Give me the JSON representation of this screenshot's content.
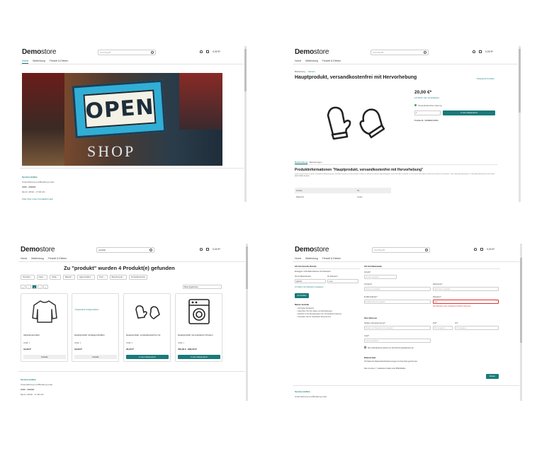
{
  "header": {
    "logo_bold": "Demo",
    "logo_light": "store",
    "search_placeholder": "Suchbegriff",
    "search_value": "produkt",
    "cart_total": "0,00 €*"
  },
  "nav": {
    "home": "Home",
    "clothing": "Bekleidung",
    "free_time": "Freizeit & Elektro"
  },
  "home": {
    "banner_word1": "OPEN",
    "banner_word2": "SHOP",
    "service_title": "Service-Hotline",
    "service_text": "Unterstützung und Beratung unter:",
    "service_phone": "0180 - 000000",
    "service_hours": "Mo-Fr, 08:00 - 17:00 Uhr",
    "service_link": "Oder über unser Kontaktformular"
  },
  "product": {
    "breadcrumb_parent": "Bekleidung",
    "breadcrumb_current": "Damen",
    "title": "Hauptprodukt, versandkostenfrei mit Hervorhebung",
    "manufacturer": "Shopware Produkt",
    "price": "20,00 €*",
    "vat": "inkl. MwSt. zzgl. Versandkosten",
    "delivery": "Versandkostenfreie Lieferung",
    "qty": "1",
    "add_to_cart": "In den Warenkorb",
    "product_no": "Produkt-Nr.: SWDEMO10001",
    "tab_desc": "Beschreibung",
    "tab_reviews": "Bewertungen",
    "info_title": "Produktinformationen \"Hauptprodukt, versandkostenfrei mit Hervorhebung\"",
    "lorem": "Lorem ipsum dolor sit amet, consetetur sadipscing elitr, sed diam nonumy eirmod tempor invidunt ut labore et dolore magna aliquyam erat, sed diam voluptua. At vero eos et accusam et justo duo dolores et ea rebum. Stet clita kasd gubergren, no sea takimata sanctus est Lorem ipsum dolor sit amet.",
    "props": [
      {
        "k": "Größe",
        "v": "51"
      },
      {
        "k": "Material",
        "v": "Leder"
      }
    ]
  },
  "search": {
    "heading": "Zu \"produkt\" wurden 4 Produkt(e) gefunden",
    "filters": [
      "Hersteller",
      "Farbe",
      "Größe",
      "Material",
      "Eigenschaften",
      "Preis",
      "Bewertung ab",
      "Versandkostenfrei"
    ],
    "sort": "Beste Ergebnisse",
    "pages": [
      "«",
      "‹",
      "1",
      "›",
      "»"
    ],
    "products": [
      {
        "name": "Variantenprodukt",
        "stock": "Inhalt: 1",
        "price": "19,99 €*",
        "button": "Details"
      },
      {
        "name": "Hauptprodukt mit Eigenschaften",
        "stock": "Inhalt: 1",
        "price": "19,99 €*",
        "button": "Details",
        "img_alt": "Hauptprodukt mit Eigenschaften"
      },
      {
        "name": "Hauptprodukt, versandkostenfrei mit",
        "stock": "Inhalt: 1",
        "price": "20,00 €*",
        "button": "In den Warenkorb"
      },
      {
        "name": "Hauptprodukt mit erweiterten Preisen",
        "stock": "Inhalt: 1",
        "price": "760,00 € - 800,00 €*",
        "button": "In den Warenkorb"
      }
    ]
  },
  "register": {
    "login_title": "Ich bin bereits Kunde",
    "login_hint": "Einloggen mit E-Mail-Adresse und Passwort",
    "email_label": "Ihre E-Mail-Adresse",
    "pw_label": "Ihr Passwort",
    "email_value": "agentur",
    "pw_value": "•••••••",
    "forgot": "Ich habe mein Passwort vergessen.",
    "login_btn": "Anmelden",
    "benefits_title": "Meine Vorteile",
    "benefits": [
      "Schnelles Einkaufen",
      "Speichern Sie Ihre Daten und Einstellungen",
      "Einblick in Ihre Bestellungen inkl. Versandinformationen",
      "Verwalten Sie Ihr Newsletter-Abonnement"
    ],
    "new_title": "Ich bin Neukunde",
    "salutation": "Anrede*",
    "salutation_ph": "Anrede eingeben",
    "firstname": "Vorname*",
    "firstname_ph": "Vorname eingeben",
    "lastname": "Nachname*",
    "lastname_ph": "Nachname eingeben",
    "email": "E-Mail-Adresse*",
    "email_ph": "E-Mail-Adresse eingeben",
    "password": "Passwort*",
    "password_value": "•••••",
    "pw_error": "Das Passwort muss mindestens 8 Zeichen lang sein.",
    "address_title": "Ihre Adresse",
    "street": "Straße und Hausnummer*",
    "street_ph": "Straße und Hausnummer eingeben",
    "zip": "PLZ*",
    "zip_ph": "PLZ eingeben",
    "city": "Ort*",
    "city_ph": "Ort eingeben",
    "country": "Land*",
    "country_ph": "Land auswählen",
    "diff_address": "Die Lieferadresse weicht von der Rechnungsadresse ab.",
    "privacy_title": "Datenschutz",
    "privacy_text": "Ich habe die Datenschutzbestimmungen zur Kenntnis genommen.",
    "required_note": "Die mit einem * markierten Felder sind Pflichtfelder.",
    "continue": "Weiter"
  }
}
